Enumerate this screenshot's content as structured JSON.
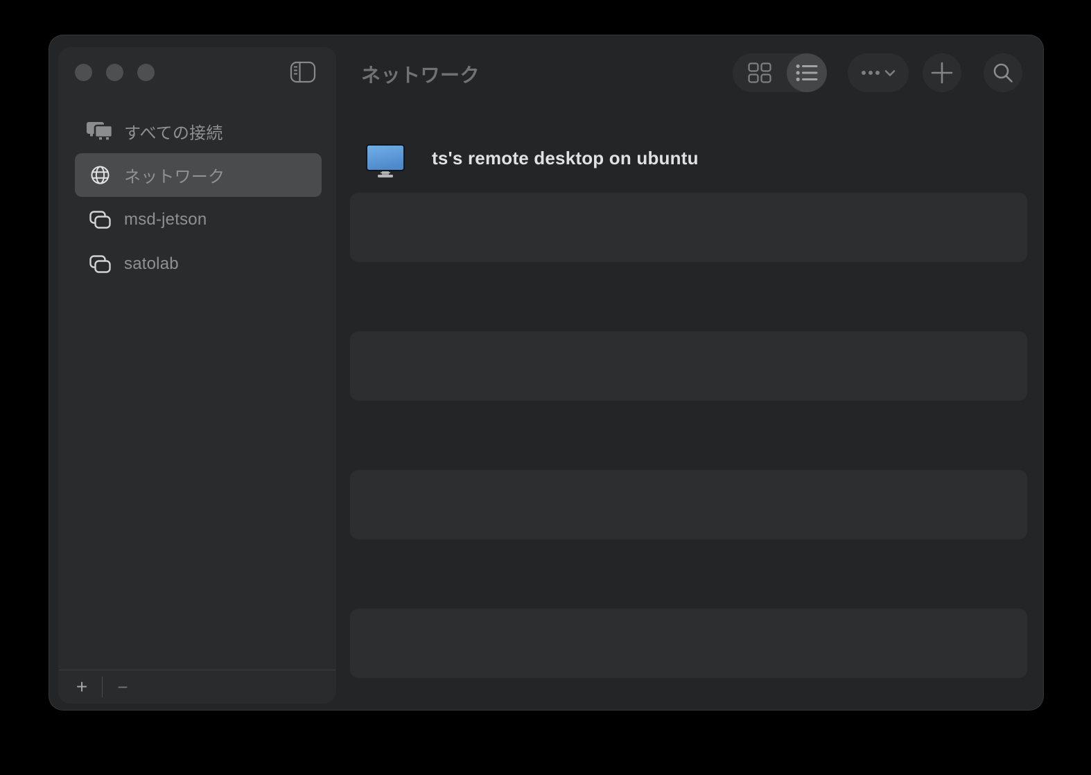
{
  "titlebar": {
    "title": "ネットワーク"
  },
  "sidebar": {
    "items": [
      {
        "label": "すべての接続",
        "icon": "displays-icon",
        "selected": false
      },
      {
        "label": "ネットワーク",
        "icon": "globe-icon",
        "selected": true
      },
      {
        "label": "msd-jetson",
        "icon": "stacked-windows-icon",
        "selected": false
      },
      {
        "label": "satolab",
        "icon": "stacked-windows-icon",
        "selected": false
      }
    ],
    "footer": {
      "add_label": "+",
      "remove_label": "−"
    }
  },
  "main": {
    "items": [
      {
        "name": "ts's remote desktop on ubuntu",
        "icon": "blue-monitor-icon"
      }
    ],
    "empty_striped_rows": 4
  },
  "toolbar_icons": [
    "grid-view-icon",
    "list-view-icon",
    "more-options-icon",
    "add-icon",
    "search-icon"
  ],
  "window_controls": [
    "close-button",
    "minimize-button",
    "zoom-button",
    "sidebar-toggle-icon"
  ],
  "view_mode_selected": "list",
  "colors": {
    "window_background": "#242526",
    "sidebar_background": "#2a2b2c",
    "stripe_row": "#2d2e2f",
    "selected_sidebar_row": "#4a4b4d",
    "toolbar_button": "#2c2d2e",
    "toolbar_selected_segment": "#454647",
    "traffic_light_inactive": "#4e4f50",
    "monitor_blue_top": "#74b0e6",
    "monitor_blue_bottom": "#4d89cb"
  }
}
